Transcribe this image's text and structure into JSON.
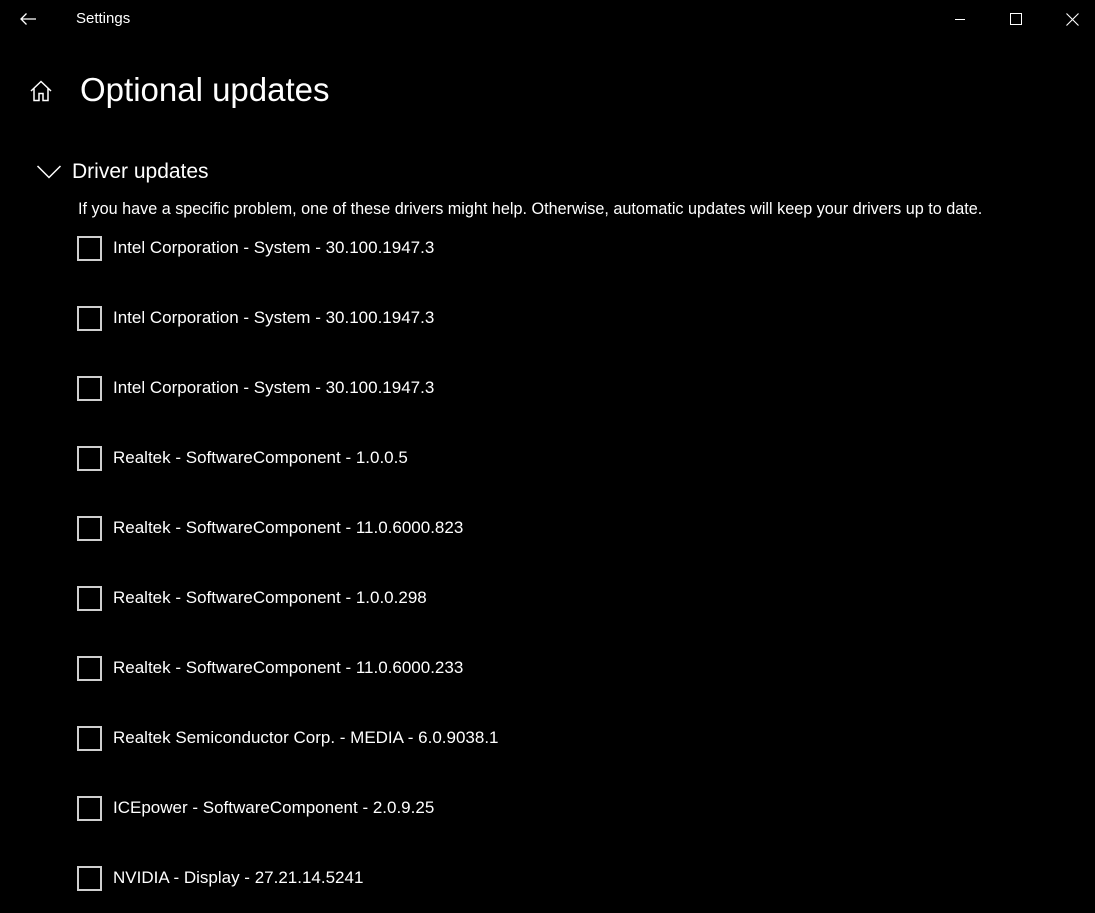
{
  "window": {
    "title": "Settings"
  },
  "page": {
    "title": "Optional updates"
  },
  "section": {
    "title": "Driver updates",
    "expanded": true,
    "description": "If you have a specific problem, one of these drivers might help. Otherwise, automatic updates will keep your drivers up to date."
  },
  "drivers": [
    {
      "label": "Intel Corporation - System - 30.100.1947.3",
      "checked": false
    },
    {
      "label": "Intel Corporation - System - 30.100.1947.3",
      "checked": false
    },
    {
      "label": "Intel Corporation - System - 30.100.1947.3",
      "checked": false
    },
    {
      "label": "Realtek - SoftwareComponent - 1.0.0.5",
      "checked": false
    },
    {
      "label": "Realtek - SoftwareComponent - 11.0.6000.823",
      "checked": false
    },
    {
      "label": "Realtek - SoftwareComponent - 1.0.0.298",
      "checked": false
    },
    {
      "label": "Realtek - SoftwareComponent - 11.0.6000.233",
      "checked": false
    },
    {
      "label": "Realtek Semiconductor Corp. - MEDIA - 6.0.9038.1",
      "checked": false
    },
    {
      "label": "ICEpower - SoftwareComponent - 2.0.9.25",
      "checked": false
    },
    {
      "label": "NVIDIA - Display - 27.21.14.5241",
      "checked": false
    }
  ],
  "icons": {
    "back": "back-arrow-icon",
    "minimize": "minimize-icon",
    "maximize": "maximize-icon",
    "close": "close-icon",
    "home": "home-icon",
    "expand": "chevron-down-icon",
    "checkbox": "checkbox-unchecked-icon"
  },
  "colors": {
    "background": "#000000",
    "text": "#ffffff",
    "checkbox_border": "#cfcfcf"
  }
}
